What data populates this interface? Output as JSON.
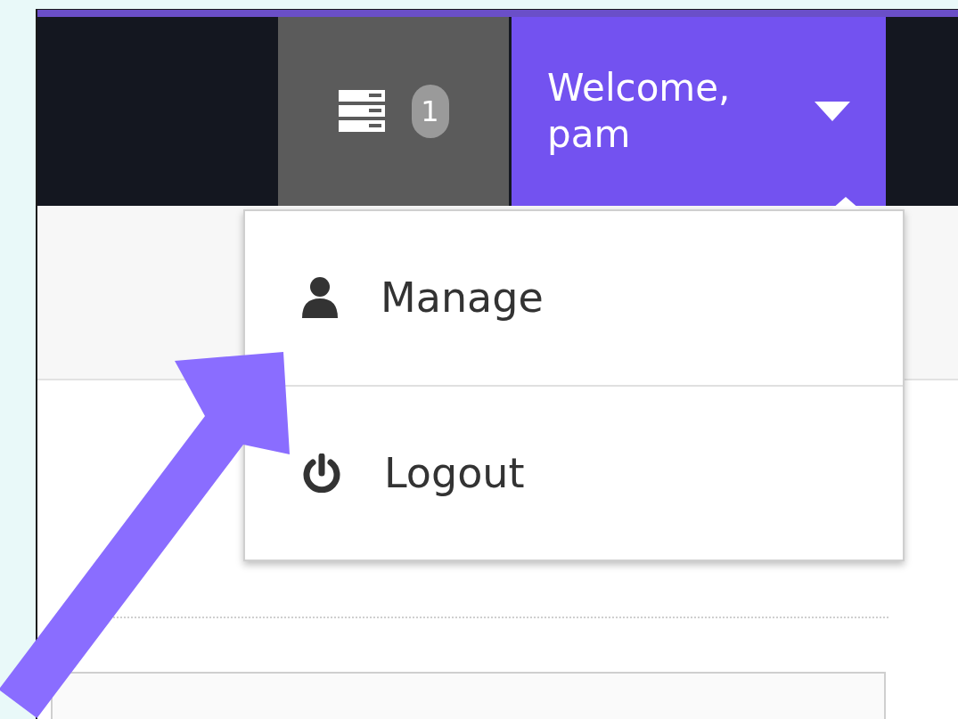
{
  "navbar": {
    "notification_count": "1",
    "user_menu": {
      "greeting": "Welcome, pam",
      "expanded": true
    }
  },
  "dropdown": {
    "items": [
      {
        "label": "Manage",
        "kind": "user"
      },
      {
        "label": "Logout",
        "kind": "power"
      }
    ]
  }
}
